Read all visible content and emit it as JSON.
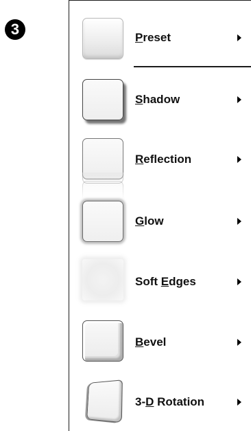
{
  "step_badge": "❸",
  "menu": {
    "items": [
      {
        "label_underlined": "P",
        "label_rest": "reset",
        "thumb": "preset-icon"
      },
      {
        "label_underlined": "S",
        "label_rest": "hadow",
        "thumb": "shadow-icon"
      },
      {
        "label_underlined": "R",
        "label_rest": "eflection",
        "thumb": "reflection-icon"
      },
      {
        "label_underlined": "G",
        "label_rest": "low",
        "thumb": "glow-icon"
      },
      {
        "label_before": "Soft ",
        "label_underlined": "E",
        "label_rest": "dges",
        "thumb": "soft-edges-icon"
      },
      {
        "label_underlined": "B",
        "label_rest": "evel",
        "thumb": "bevel-icon"
      },
      {
        "label_before": "3-",
        "label_underlined": "D",
        "label_rest": " Rotation",
        "thumb": "3d-rotation-icon"
      }
    ]
  }
}
